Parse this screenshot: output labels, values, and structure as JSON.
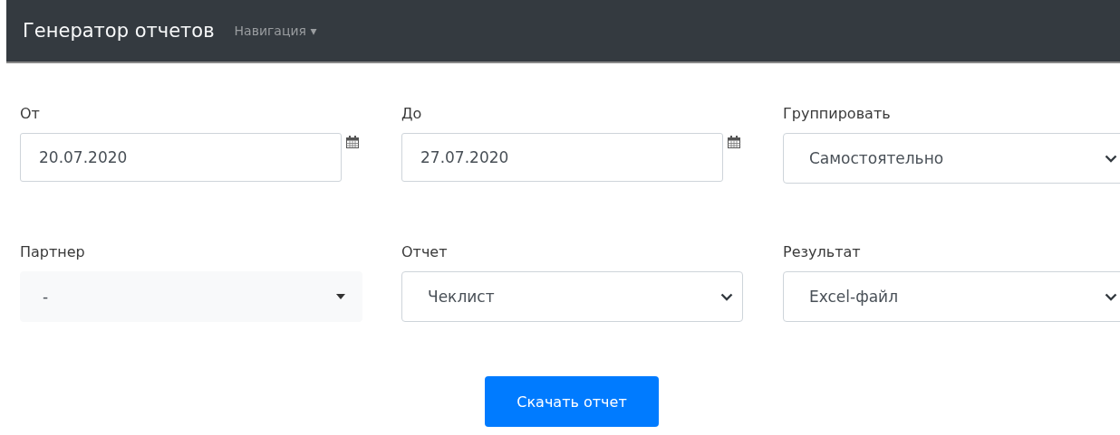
{
  "navbar": {
    "brand": "Генератор отчетов",
    "menu": {
      "label": "Навигация",
      "caret": "▾"
    }
  },
  "fields": [
    {
      "kind": "date",
      "label": "От",
      "value": "20.07.2020"
    },
    {
      "kind": "date",
      "label": "До",
      "value": "27.07.2020"
    },
    {
      "kind": "select",
      "label": "Группировать",
      "value": "Самостоятельно"
    },
    {
      "kind": "dropdown",
      "label": "Партнер",
      "value": "-"
    },
    {
      "kind": "select",
      "label": "Отчет",
      "value": "Чеклист"
    },
    {
      "kind": "select",
      "label": "Результат",
      "value": "Excel-файл"
    }
  ],
  "submit": "Скачать отчет"
}
